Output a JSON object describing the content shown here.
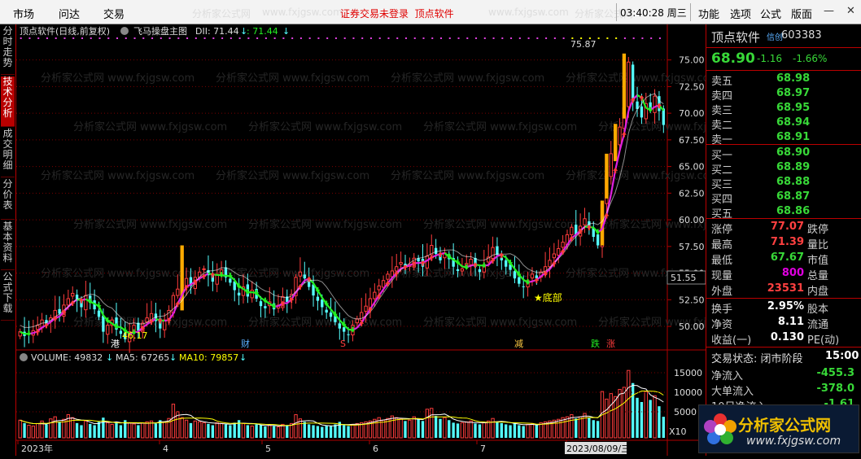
{
  "topbar": {
    "menu": [
      "市场",
      "问达",
      "交易"
    ],
    "watermarks": [
      "分析家公式网",
      "www.fxjgsw.com",
      "分析家公式网",
      "www.fxjgsw.com",
      "分析家公式网"
    ],
    "notice": "证券交易未登录",
    "notice2": "顶点软件",
    "time": "03:40:28 周三",
    "right_menu": [
      "功能",
      "选项",
      "公式",
      "版面"
    ],
    "win_buttons": [
      "—",
      "❐",
      "✕"
    ]
  },
  "side_tabs": [
    {
      "label": "分时走势",
      "active": false
    },
    {
      "label": "技术分析",
      "active": true
    },
    {
      "label": "成交明细",
      "active": false
    },
    {
      "label": "分价表",
      "active": false
    },
    {
      "label": "基本资料",
      "active": false
    },
    {
      "label": "公式下载",
      "active": false
    }
  ],
  "chart_header": {
    "stock": "顶点软件(日线,前复权)",
    "indicator": "飞马操盘主图",
    "dii": "DII: 71.44",
    "dii_arrow": "↓",
    "dii2": ": 71.44",
    "dii2_arrow": "↓"
  },
  "chart_watermark": "分析家公式网 www.fxjgsw.com",
  "chart_data": [
    {
      "type": "candlestick",
      "y_axis": {
        "ticks": [
          "75.00",
          "72.50",
          "70.00",
          "67.50",
          "65.00",
          "62.50",
          "60.00",
          "57.50",
          "55.00",
          "52.50",
          "50.00"
        ],
        "range": [
          48.4,
          76.5
        ]
      },
      "x_axis": {
        "labels": [
          "2023年",
          "4",
          "5",
          "6",
          "7",
          "2023/08/09/三"
        ]
      },
      "current_price_label": "51.55",
      "annotations": {
        "high": "75.87",
        "low": "46.17",
        "bottom": "★底部",
        "markers": [
          "港",
          "财",
          "S",
          "减",
          "跌",
          "涨"
        ]
      },
      "close": [
        49.5,
        49.1,
        49.3,
        49.6,
        50.1,
        50.6,
        50.2,
        50.8,
        51.5,
        51.2,
        52.0,
        52.6,
        53.1,
        52.4,
        51.8,
        52.9,
        52.2,
        51.6,
        50.9,
        49.5,
        50.1,
        50.6,
        49.7,
        49.3,
        48.8,
        49.5,
        50.1,
        49.6,
        50.3,
        50.8,
        51.2,
        50.5,
        49.8,
        50.6,
        51.5,
        52.9,
        53.5,
        53.9,
        54.5,
        53.8,
        54.6,
        55.1,
        55.4,
        54.8,
        54.2,
        54.9,
        55.3,
        54.6,
        54.1,
        53.4,
        52.9,
        53.7,
        52.8,
        53.4,
        52.6,
        51.9,
        51.7,
        52.3,
        51.6,
        52.0,
        52.8,
        52.3,
        53.0,
        54.6,
        55.1,
        54.5,
        53.7,
        52.9,
        52.4,
        51.8,
        51.3,
        50.9,
        50.4,
        49.8,
        49.5,
        49.2,
        50.1,
        50.7,
        51.3,
        51.9,
        52.6,
        53.2,
        53.8,
        54.3,
        54.9,
        55.2,
        55.6,
        56.0,
        55.5,
        55.8,
        56.4,
        56.1,
        55.6,
        56.6,
        57.6,
        56.8,
        56.2,
        56.9,
        56.3,
        55.6,
        55.2,
        55.4,
        55.9,
        56.3,
        55.6,
        55.1,
        55.8,
        56.5,
        57.4,
        56.7,
        56.2,
        55.6,
        55.3,
        54.5,
        54.0,
        53.7,
        54.3,
        54.9,
        54.5,
        55.1,
        55.6,
        56.2,
        56.8,
        57.3,
        57.9,
        58.6,
        59.3,
        58.6,
        59.4,
        60.1,
        59.2,
        58.4,
        57.6,
        61.4,
        64.3,
        66.2,
        66.8,
        68.7,
        70.5,
        74.8,
        71.1,
        70.4,
        69.6,
        70.9,
        70.3,
        71.6,
        70.2,
        68.9
      ],
      "volume_panel": {
        "title": "VOLUME: 49832",
        "title_arrow": "↓",
        "ma5": "MA5: 67265",
        "ma5_arrow": "↓",
        "ma10": "MA10: 79857",
        "ma10_arrow": "↓",
        "y_ticks": [
          "15000",
          "10000",
          "5000"
        ],
        "unit": "X10",
        "volume": [
          42,
          35,
          30,
          28,
          34,
          40,
          32,
          45,
          50,
          38,
          44,
          55,
          48,
          35,
          30,
          40,
          33,
          30,
          38,
          48,
          36,
          32,
          35,
          30,
          42,
          36,
          33,
          30,
          35,
          38,
          40,
          34,
          42,
          38,
          46,
          80,
          62,
          48,
          42,
          35,
          40,
          38,
          36,
          33,
          30,
          36,
          34,
          32,
          30,
          36,
          42,
          34,
          30,
          28,
          32,
          30,
          27,
          30,
          28,
          26,
          32,
          30,
          34,
          55,
          45,
          38,
          32,
          30,
          28,
          26,
          30,
          28,
          32,
          38,
          30,
          28,
          32,
          34,
          36,
          38,
          40,
          44,
          48,
          42,
          46,
          52,
          48,
          45,
          40,
          42,
          50,
          44,
          40,
          68,
          70,
          52,
          45,
          48,
          42,
          36,
          34,
          36,
          38,
          40,
          34,
          32,
          36,
          40,
          46,
          38,
          35,
          32,
          30,
          36,
          30,
          28,
          32,
          34,
          30,
          36,
          38,
          40,
          42,
          44,
          48,
          50,
          55,
          46,
          50,
          58,
          48,
          42,
          40,
          110,
          92,
          105,
          98,
          115,
          120,
          160,
          130,
          95,
          85,
          110,
          90,
          100,
          75,
          50
        ]
      }
    }
  ],
  "right_panel": {
    "stock_name": "顶点软件",
    "badge": "信创",
    "code": "603383",
    "price": "68.90",
    "change": "-1.16",
    "change_pct": "-1.66%",
    "asks": [
      {
        "label": "卖五",
        "price": "68.98"
      },
      {
        "label": "卖四",
        "price": "68.97"
      },
      {
        "label": "卖三",
        "price": "68.95"
      },
      {
        "label": "卖二",
        "price": "68.94"
      },
      {
        "label": "卖一",
        "price": "68.91"
      }
    ],
    "bids": [
      {
        "label": "买一",
        "price": "68.90"
      },
      {
        "label": "买二",
        "price": "68.89"
      },
      {
        "label": "买三",
        "price": "68.88"
      },
      {
        "label": "买四",
        "price": "68.87"
      },
      {
        "label": "买五",
        "price": "68.86"
      }
    ],
    "stats1": [
      {
        "label": "涨停",
        "value": "77.07",
        "color": "#ff4040",
        "label2": "跌停"
      },
      {
        "label": "最高",
        "value": "71.39",
        "color": "#ff4040",
        "label2": "量比"
      },
      {
        "label": "最低",
        "value": "67.67",
        "color": "#38d838",
        "label2": "市值"
      },
      {
        "label": "现量",
        "value": "800",
        "color": "#e000e0",
        "label2": "总量"
      },
      {
        "label": "外盘",
        "value": "23531",
        "color": "#ff4040",
        "label2": "内盘"
      }
    ],
    "stats2": [
      {
        "label": "换手",
        "value": "2.95%",
        "color": "#ffffff",
        "label2": "股本"
      },
      {
        "label": "净资",
        "value": "8.11",
        "color": "#ffffff",
        "label2": "流通"
      },
      {
        "label": "收益(一)",
        "value": "0.130",
        "color": "#ffffff",
        "label2": "PE(动)"
      }
    ],
    "status": "交易状态: 闭市阶段",
    "status_time": "15:00",
    "flows": [
      {
        "label": "净流入",
        "value": "-455.3"
      },
      {
        "label": "大单流入",
        "value": "-378.0"
      },
      {
        "label": "10日净流入",
        "value": "-1.61"
      }
    ]
  },
  "watermark_logo": {
    "title": "分析家公式网",
    "url": "www.fxjgsw.com"
  },
  "colors": {
    "up": "#ff3c3c",
    "down": "#54ffff",
    "ma_green": "#22ee22",
    "ma_magenta": "#e020e0",
    "gold": "#ffaa00",
    "grid": "#7a0000",
    "text_dim": "#cccccc"
  }
}
